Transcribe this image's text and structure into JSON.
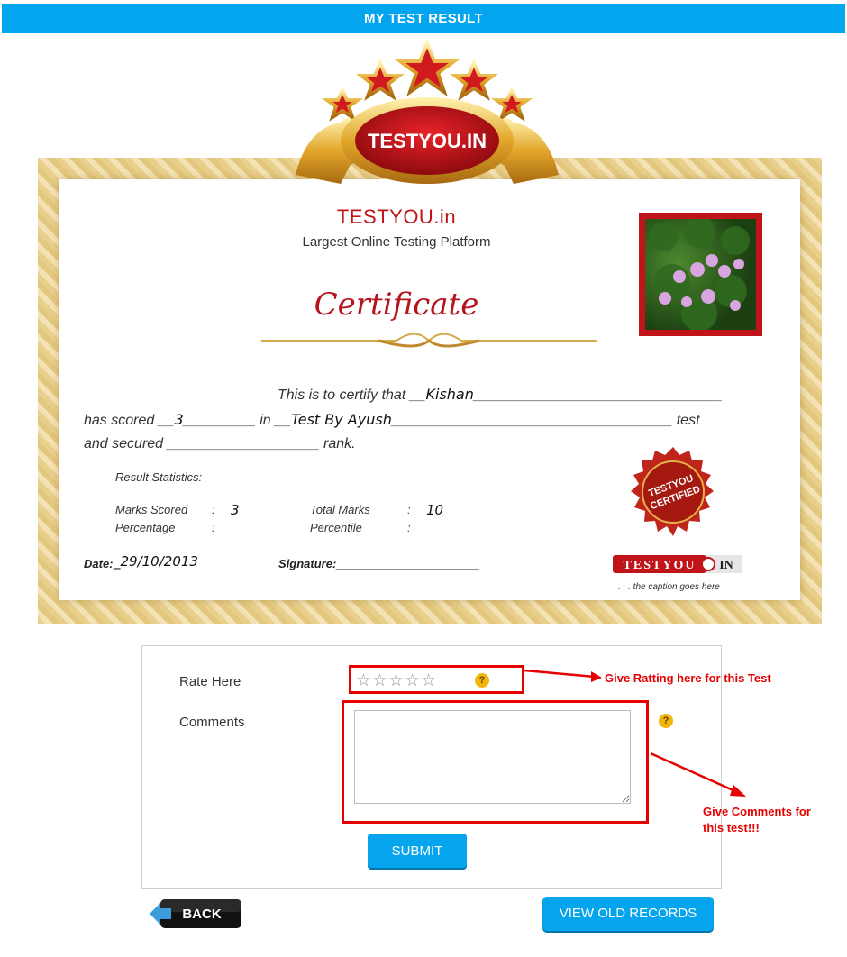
{
  "header": {
    "title": "MY TEST RESULT"
  },
  "emblem": {
    "text": "TESTYOU.IN"
  },
  "certificate": {
    "brand": "TESTYOU.in",
    "tagline": "Largest Online Testing Platform",
    "heading": "Certificate",
    "line1_prefix": "This is to certify that __",
    "name": "Kishan",
    "line1_suffix": "_______________________________",
    "line2_prefix": "has scored __",
    "score": "3",
    "line2_mid": "_________ in __",
    "test_name": "Test By Ayush",
    "line2_suffix": "___________________________________ test",
    "line3": "and secured ___________________ rank.",
    "stats_heading": "Result Statistics:",
    "marks_scored_label": "Marks Scored",
    "marks_scored_value": "3",
    "total_marks_label": "Total Marks",
    "total_marks_value": "10",
    "percentage_label": "Percentage",
    "percentile_label": "Percentile",
    "colon": ":",
    "date_label": "Date:",
    "date_value": "_29/10/2013",
    "signature_label": "Signature:______________________",
    "seal_text_1": "TESTYOU",
    "seal_text_2": "CERTIFIED",
    "logo_left": "TESTYOU",
    "logo_right": "IN",
    "caption": ". . . the caption goes here"
  },
  "form": {
    "rate_label": "Rate Here",
    "stars": "☆☆☆☆☆",
    "rating": 0,
    "help_glyph": "?",
    "comments_label": "Comments",
    "comments_value": "",
    "submit_label": "SUBMIT"
  },
  "annotations": {
    "rating_note": "Give Ratting here for this Test",
    "comments_note_1": "Give Comments for",
    "comments_note_2": "this test!!!"
  },
  "nav": {
    "back_label": "BACK",
    "old_records_label": "VIEW OLD RECORDS"
  },
  "colors": {
    "accent": "#03a5ee",
    "brand_red": "#c0141a",
    "annotation_red": "#e60000",
    "gold": "#e9cf8c"
  }
}
